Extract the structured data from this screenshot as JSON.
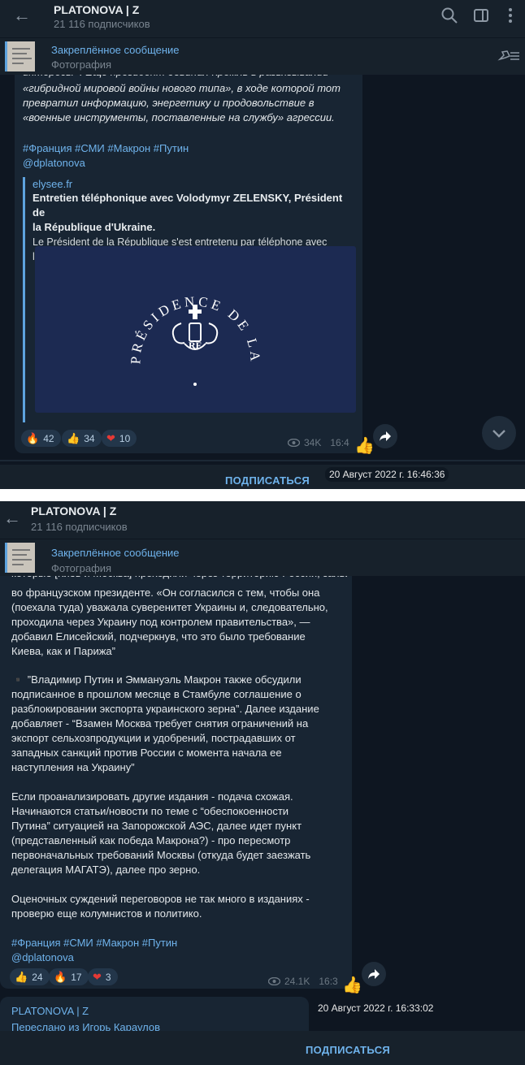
{
  "panel1": {
    "header": {
      "title": "PLATONOVA | Z",
      "subscribers": "21 116 подписчиков"
    },
    "pinned": {
      "title": "Закреплённое сообщение",
      "subtitle": "Фотография"
    },
    "message": {
      "partial_line": "интересы». Еще президент обвинил Кремль в развязывании",
      "italic_text": "«гибридной мировой войны нового типа», в ходе которой тот\nпревратил информацию, энергетику и продовольствие в\n«военные инструменты, поставленные на службу» агрессии.",
      "hashtags": "#Франция #СМИ #Макрон #Путин",
      "mention": "@dplatonova",
      "preview": {
        "site": "elysee.fr",
        "title": "Entretien téléphonique avec Volodymyr ZELENSKY, Président de\nla République d'Ukraine.",
        "description": "Le Président de la République s'est entretenu par téléphone avec\nle Président de l'Ukraine, M. Volodymyr ZELENSKY, ce lundi 1er a...",
        "seal_text": "PRÉSIDENCE DE LA RÉPUBLIQUE",
        "seal_monogram": "RF"
      },
      "reactions": [
        {
          "emoji": "🔥",
          "count": "42"
        },
        {
          "emoji": "👍",
          "count": "34"
        },
        {
          "emoji": "❤",
          "count": "10"
        }
      ],
      "views": "34K",
      "time": "16:4"
    },
    "date_tooltip": "20 Август 2022 г. 16:46:36",
    "subscribe_label": "ПОДПИСАТЬСЯ"
  },
  "panel2": {
    "header": {
      "title": "PLATONOVA | Z",
      "subscribers": "21 116 подписчиков"
    },
    "pinned": {
      "title": "Закреплённое сообщение",
      "subtitle": "Фотография"
    },
    "message": {
      "partial_line": "которые [Киев и Москва] проходили через территорию России, заявили",
      "paragraph1": "во французском президенте. «Он согласился с тем, чтобы она\n(поехала туда) уважала суверенитет Украины и, следовательно,\nпроходила через Украину под контролем правительства», —\nдобавил Елисейский, подчеркнув, что это было требование\nКиева, как и Парижа”",
      "paragraph2": "▪️ ”Владимир Путин и Эммануэль Макрон также обсудили\nподписанное в прошлом месяце в Стамбуле соглашение о\nразблокировании экспорта украинского зерна”. Далее издание\nдобавляет - “Взамен Москва требует снятия ограничений на\nэкспорт сельхозпродукции и удобрений, пострадавших от\nзападных санкций против России с момента начала ее\nнаступления на Украину”",
      "paragraph3": "Если проанализировать другие издания - подача схожая.\nНачинаются статьи/новости по теме с “обеспокоенности\nПутина” ситуацией на Запорожской АЭС, далее идет пункт\n(представленный как победа Макрона?) - про пересмотр\nпервоначальных требований Москвы (откуда будет заезжать\nделегация МАГАТЭ), далее про зерно.",
      "paragraph4": "Оценочных суждений переговоров не так много в изданиях -\nпроверю еще колумнистов и политико.",
      "hashtags": "#Франция #СМИ #Макрон #Путин",
      "mention": "@dplatonova",
      "reactions": [
        {
          "emoji": "👍",
          "count": "24"
        },
        {
          "emoji": "🔥",
          "count": "17"
        },
        {
          "emoji": "❤",
          "count": "3"
        }
      ],
      "views": "24.1K",
      "time": "16:3"
    },
    "date_tooltip": "20 Август 2022 г. 16:33:02",
    "next_message": {
      "author": "PLATONOVA | Z",
      "forwarded": "Переслано из Игорь Караулов"
    },
    "subscribe_label": "ПОДПИСАТЬСЯ"
  },
  "colors": {
    "background": "#0e1621",
    "header": "#17212b",
    "bubble": "#182533",
    "accent": "#6fb3ec"
  }
}
